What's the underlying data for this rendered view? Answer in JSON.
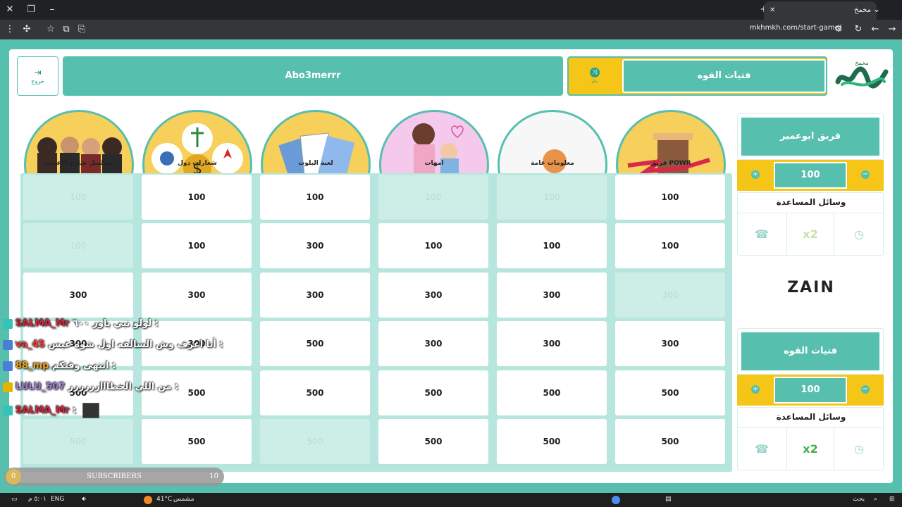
{
  "browser": {
    "tab_title": "مخمخ",
    "url": "mkhmkh.com/start-game/"
  },
  "header": {
    "exit_label": "خروج",
    "current_player": "Abo3merrr",
    "switch_label": "بدل",
    "turn_team": "فتيات القوه",
    "logo_text": "مخمخ"
  },
  "categories": [
    {
      "label": "مسلسل شارع الأعشى",
      "color": "#f6d05a"
    },
    {
      "label": "شعارات دول",
      "color": "#f6d05a"
    },
    {
      "label": "لعبة البلوت",
      "color": "#f6d05a"
    },
    {
      "label": "امهات",
      "color": "#f4c9ec"
    },
    {
      "label": "معلومات عامة",
      "color": "#f7f7f7"
    },
    {
      "label": "فريق POWR",
      "color": "#f6d05a"
    }
  ],
  "grid": {
    "rows": [
      [
        {
          "v": "100",
          "used": true
        },
        {
          "v": "100",
          "used": false
        },
        {
          "v": "100",
          "used": false
        },
        {
          "v": "100",
          "used": true
        },
        {
          "v": "100",
          "used": true
        },
        {
          "v": "100",
          "used": false
        }
      ],
      [
        {
          "v": "100",
          "used": true
        },
        {
          "v": "100",
          "used": false
        },
        {
          "v": "300",
          "used": false
        },
        {
          "v": "100",
          "used": false
        },
        {
          "v": "100",
          "used": false
        },
        {
          "v": "100",
          "used": false
        }
      ],
      [
        {
          "v": "300",
          "used": false
        },
        {
          "v": "300",
          "used": false
        },
        {
          "v": "300",
          "used": false
        },
        {
          "v": "300",
          "used": false
        },
        {
          "v": "300",
          "used": false
        },
        {
          "v": "300",
          "used": true
        }
      ],
      [
        {
          "v": "300",
          "used": false
        },
        {
          "v": "300",
          "used": false
        },
        {
          "v": "500",
          "used": false
        },
        {
          "v": "300",
          "used": false
        },
        {
          "v": "300",
          "used": false
        },
        {
          "v": "300",
          "used": false
        }
      ],
      [
        {
          "v": "500",
          "used": false
        },
        {
          "v": "500",
          "used": false
        },
        {
          "v": "500",
          "used": false
        },
        {
          "v": "500",
          "used": false
        },
        {
          "v": "500",
          "used": false
        },
        {
          "v": "500",
          "used": false
        }
      ],
      [
        {
          "v": "500",
          "used": true
        },
        {
          "v": "500",
          "used": false
        },
        {
          "v": "500",
          "used": true
        },
        {
          "v": "500",
          "used": false
        },
        {
          "v": "500",
          "used": false
        },
        {
          "v": "500",
          "used": false
        }
      ]
    ]
  },
  "teams": [
    {
      "name": "فريق ابوعمير",
      "score": "100",
      "aids_title": "وسائل المساعدة",
      "aid_double": "x2"
    },
    {
      "name": "فتيات القوه",
      "score": "100",
      "aids_title": "وسائل المساعدة",
      "aid_double": "x2"
    }
  ],
  "sponsor": "ZAIN",
  "chat": [
    {
      "user": "SALMA_Mr",
      "msg": "لولو نبي باور ٦٠٠ :",
      "color": "#d2263c",
      "badge": "#35c3b7"
    },
    {
      "user": "va_45",
      "msg": "أنا اعرف وش السالفه اول شوه عيس :",
      "color": "#ff3b3b",
      "badge": "#4a7fd6"
    },
    {
      "user": "88_mp",
      "msg": "انتهى وقتكم :",
      "color": "#f0a21c",
      "badge": "#4a7fd6"
    },
    {
      "user": "LULU_507",
      "msg": "من اللي الخطااارررررر :",
      "color": "#a07ad6",
      "badge": "#e0b400"
    },
    {
      "user": "SALMA_Mr",
      "msg": ":",
      "color": "#d2263c",
      "badge": "#35c3b7"
    }
  ],
  "subscribers": {
    "label": "SUBSCRIBERS",
    "left": "0",
    "right": "10"
  },
  "taskbar": {
    "time": "٥:٠١ م",
    "lang": "ENG",
    "temp": "41°C",
    "weather": "مشمس",
    "search": "بحث"
  }
}
